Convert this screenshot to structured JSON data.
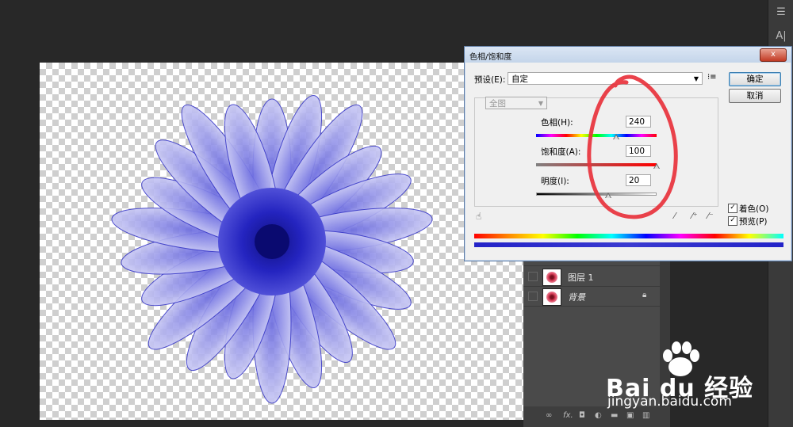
{
  "dialog": {
    "title": "色相/饱和度",
    "close_label": "x",
    "preset_label": "预设(E):",
    "preset_value": "自定",
    "preset_menu_icon": "menu-list-icon",
    "ok_label": "确定",
    "cancel_label": "取消",
    "channel_value": "全图",
    "hue": {
      "label": "色相(H):",
      "value": "240",
      "min": -180,
      "max": 180
    },
    "saturation": {
      "label": "饱和度(A):",
      "value": "100",
      "min": -100,
      "max": 100
    },
    "lightness": {
      "label": "明度(I):",
      "value": "20",
      "min": -100,
      "max": 100
    },
    "colorize": {
      "label": "着色(O)",
      "checked": true
    },
    "preview": {
      "label": "预览(P)",
      "checked": true
    },
    "tools": [
      "hand-adjust-icon",
      "eyedropper-icon",
      "eyedropper-plus-icon",
      "eyedropper-minus-icon"
    ]
  },
  "layers": [
    {
      "name": "图层 1",
      "locked": false
    },
    {
      "name": "背景",
      "locked": true
    }
  ],
  "layers_footer_icons": [
    "link-icon",
    "fx-icon",
    "mask-icon",
    "adjustment-icon",
    "folder-icon",
    "new-layer-icon",
    "trash-icon"
  ],
  "layers_footer_fx": "fx.",
  "toolbar_icons": [
    "sliders-icon",
    "character-icon",
    "paragraph-icon"
  ],
  "toolbar_char": "A|",
  "watermark": {
    "brand": "Bai du 经验",
    "url": "jingyan.baidu.com"
  },
  "colors": {
    "annotation": "#e8323c",
    "dialog_border": "#5f7da6",
    "flower": "#2a2ad0"
  }
}
